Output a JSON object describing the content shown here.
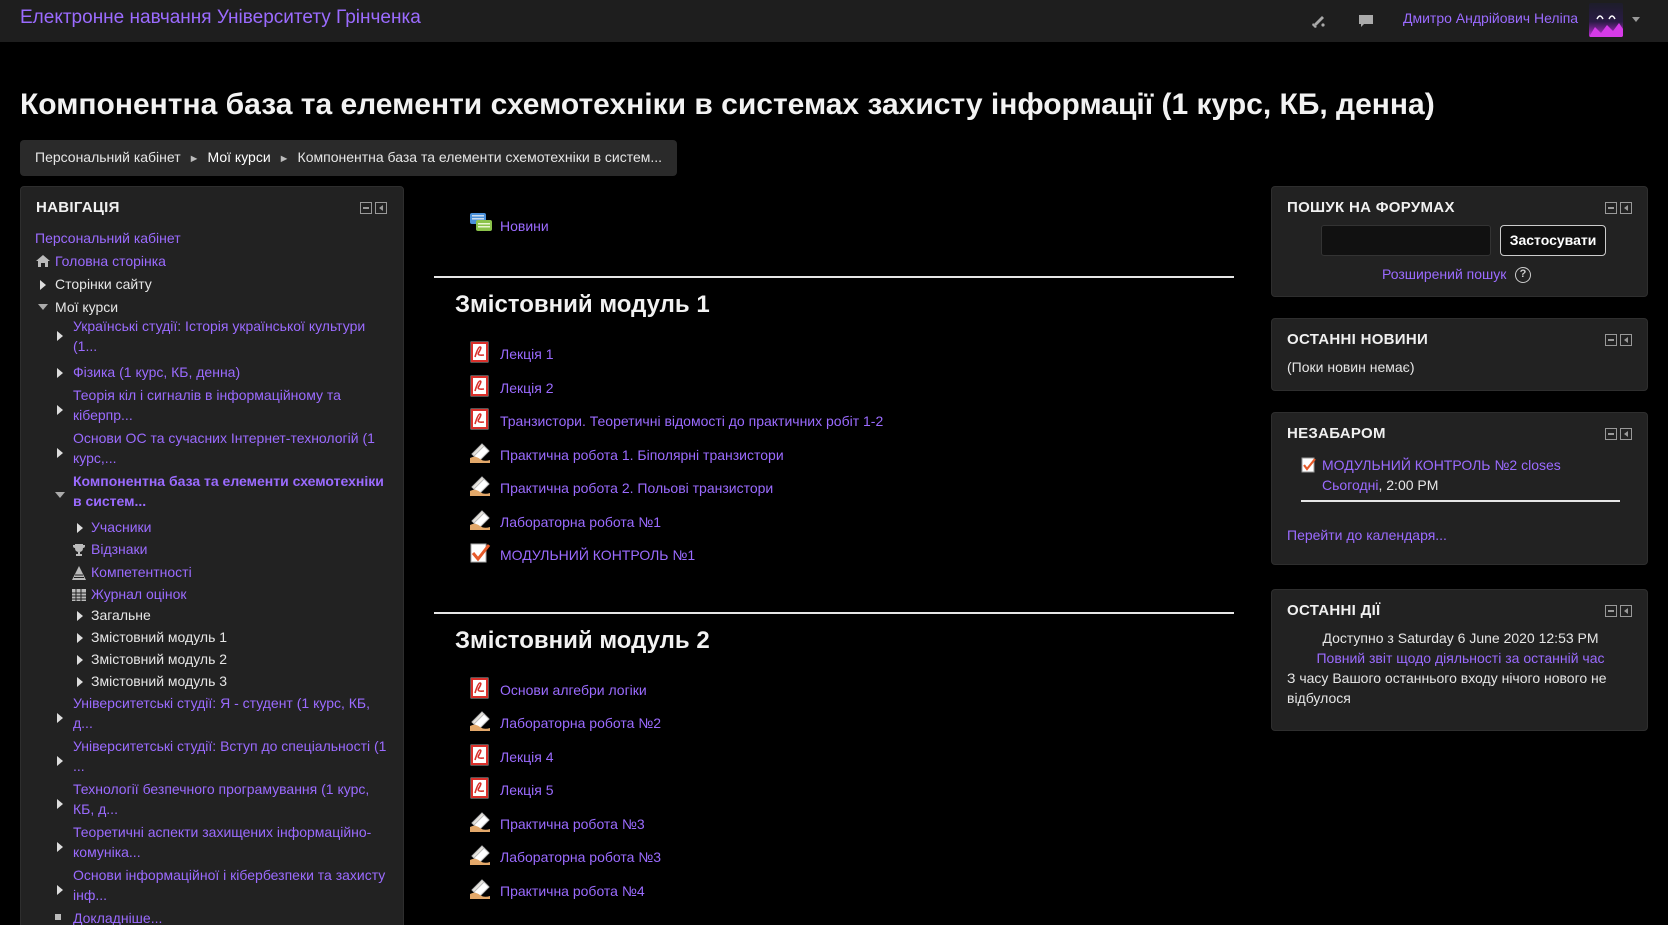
{
  "navbar": {
    "site_name": "Електронне навчання Університету Грінченка",
    "user_name": "Дмитро Андрійович Неліпа"
  },
  "page": {
    "title": "Компонентна база та елементи схемотехніки в системах захисту інформації (1 курс, КБ, денна)"
  },
  "breadcrumb": {
    "items": [
      "Персональний кабінет",
      "Мої курси",
      "Компонентна база та елементи схемотехніки в систем..."
    ],
    "separator": "►"
  },
  "navigation": {
    "title": "НАВІГАЦІЯ",
    "dashboard": "Персональний кабінет",
    "home": "Головна сторінка",
    "site_pages": "Сторінки сайту",
    "my_courses": "Мої курси",
    "courses": [
      [
        "Українські студії: Історія української культури",
        "(1..."
      ],
      [
        "Фізика (1 курс, КБ, денна)"
      ],
      [
        "Теорія кіл і сигналів в інформаційному та",
        "кіберпр..."
      ],
      [
        "Основи ОС та сучасних Інтернет-технологій (1",
        "курс,..."
      ]
    ],
    "current_course": [
      "Компонентна база та елементи схемотехніки",
      "в систем..."
    ],
    "current_children": [
      "Учасники",
      "Відзнаки",
      "Компетентності",
      "Журнал оцінок",
      "Загальне",
      "Змістовний модуль 1",
      "Змістовний модуль 2",
      "Змістовний модуль 3"
    ],
    "more_courses": [
      [
        "Університетські студії: Я - студент (1 курс, КБ,",
        "д..."
      ],
      [
        "Університетські студії: Вступ до спеціальності (1",
        "..."
      ],
      [
        "Технології безпечного програмування (1 курс,",
        "КБ, д..."
      ],
      [
        "Теоретичні аспекти захищених інформаційно-",
        "комуніка..."
      ],
      [
        "Основи інформаційної і кібербезпеки та захисту",
        "інф..."
      ]
    ],
    "more": "Докладніше..."
  },
  "main": {
    "news": "Новини",
    "sections": [
      {
        "title": "Змістовний модуль 1",
        "items": [
          {
            "label": "Лекція 1",
            "icon": "pdf"
          },
          {
            "label": "Лекція 2",
            "icon": "pdf"
          },
          {
            "label": "Транзистори. Теоретичні відомості до практичних робіт 1-2",
            "icon": "pdf"
          },
          {
            "label": "Практична робота 1. Біполярні транзистори",
            "icon": "assign"
          },
          {
            "label": "Практична робота 2. Польові транзистори",
            "icon": "assign"
          },
          {
            "label": "Лабораторна робота №1",
            "icon": "assign"
          },
          {
            "label": "МОДУЛЬНИЙ КОНТРОЛЬ №1",
            "icon": "quiz"
          }
        ]
      },
      {
        "title": "Змістовний модуль 2",
        "items": [
          {
            "label": "Основи алгебри логіки",
            "icon": "pdf"
          },
          {
            "label": "Лабораторна робота №2",
            "icon": "assign"
          },
          {
            "label": "Лекція 4",
            "icon": "pdf"
          },
          {
            "label": "Лекція 5",
            "icon": "pdf"
          },
          {
            "label": "Практична робота №3",
            "icon": "assign"
          },
          {
            "label": "Лабораторна робота №3",
            "icon": "assign"
          },
          {
            "label": "Практична робота №4",
            "icon": "assign"
          }
        ]
      }
    ]
  },
  "forum_search": {
    "title": "ПОШУК НА ФОРУМАХ",
    "button": "Застосувати",
    "advanced": "Розширений пошук"
  },
  "latest_news": {
    "title": "ОСТАННІ НОВИНИ",
    "empty": "(Поки новин немає)"
  },
  "upcoming": {
    "title": "НЕЗАБАРОМ",
    "event_name": "МОДУЛЬНИЙ КОНТРОЛЬ №2 closes",
    "event_day": "Сьогодні",
    "event_time": ", 2:00 PM",
    "calendar_link": "Перейти до календаря..."
  },
  "recent_activity": {
    "title": "ОСТАННІ ДІЇ",
    "since": "Доступно з Saturday 6 June 2020 12:53 PM",
    "full_report": "Повний звіт щодо діяльності за останній час",
    "nothing_new": [
      "З часу Вашого останнього входу нічого нового не",
      "відбулося"
    ]
  },
  "colors": {
    "link": "#9b6bff",
    "background": "#000000",
    "block": "#222222",
    "navbar": "#1e1e1e"
  }
}
